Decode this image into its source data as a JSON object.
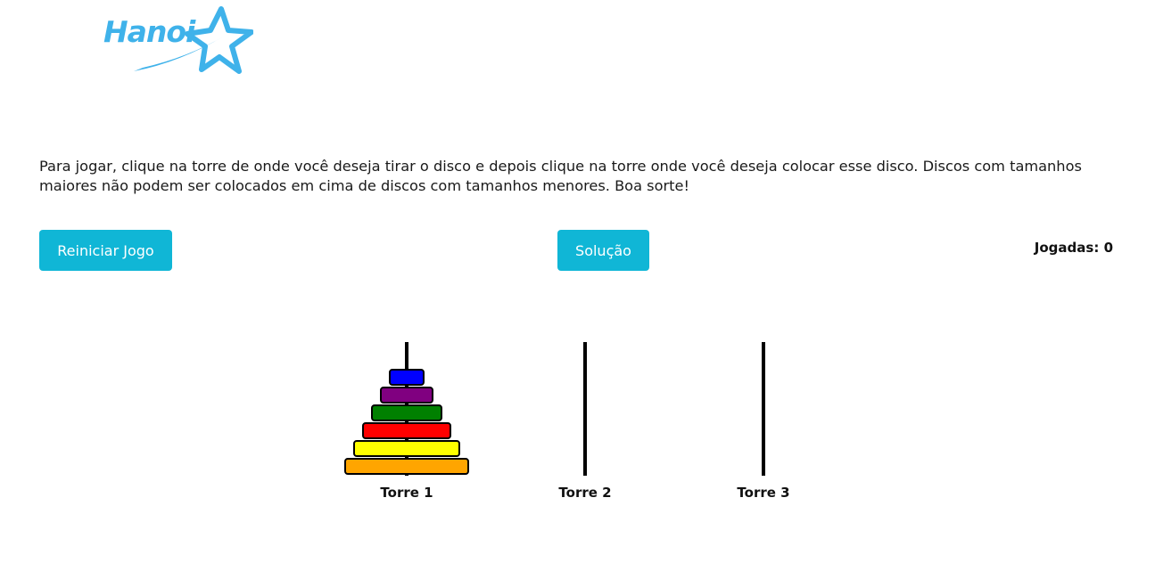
{
  "logo": {
    "text": "Hanoi",
    "color": "#3fb2ea",
    "icon": "star-icon"
  },
  "instructions": "Para jogar, clique na torre de onde você deseja tirar o disco e depois clique na torre onde você deseja colocar esse disco. Discos com tamanhos maiores não podem ser colocados em cima de discos com tamanhos menores. Boa sorte!",
  "buttons": {
    "restart_label": "Reiniciar Jogo",
    "solution_label": "Solução",
    "color": "#10b6d6"
  },
  "moves": {
    "label": "Jogadas:",
    "count": "0"
  },
  "towers": [
    {
      "label": "Torre 1",
      "disks": [
        {
          "size": 6,
          "color": "#ffa500"
        },
        {
          "size": 5,
          "color": "#ffff00"
        },
        {
          "size": 4,
          "color": "#ff0000"
        },
        {
          "size": 3,
          "color": "#008000"
        },
        {
          "size": 2,
          "color": "#800080"
        },
        {
          "size": 1,
          "color": "#0000ff"
        }
      ]
    },
    {
      "label": "Torre 2",
      "disks": []
    },
    {
      "label": "Torre 3",
      "disks": []
    }
  ]
}
